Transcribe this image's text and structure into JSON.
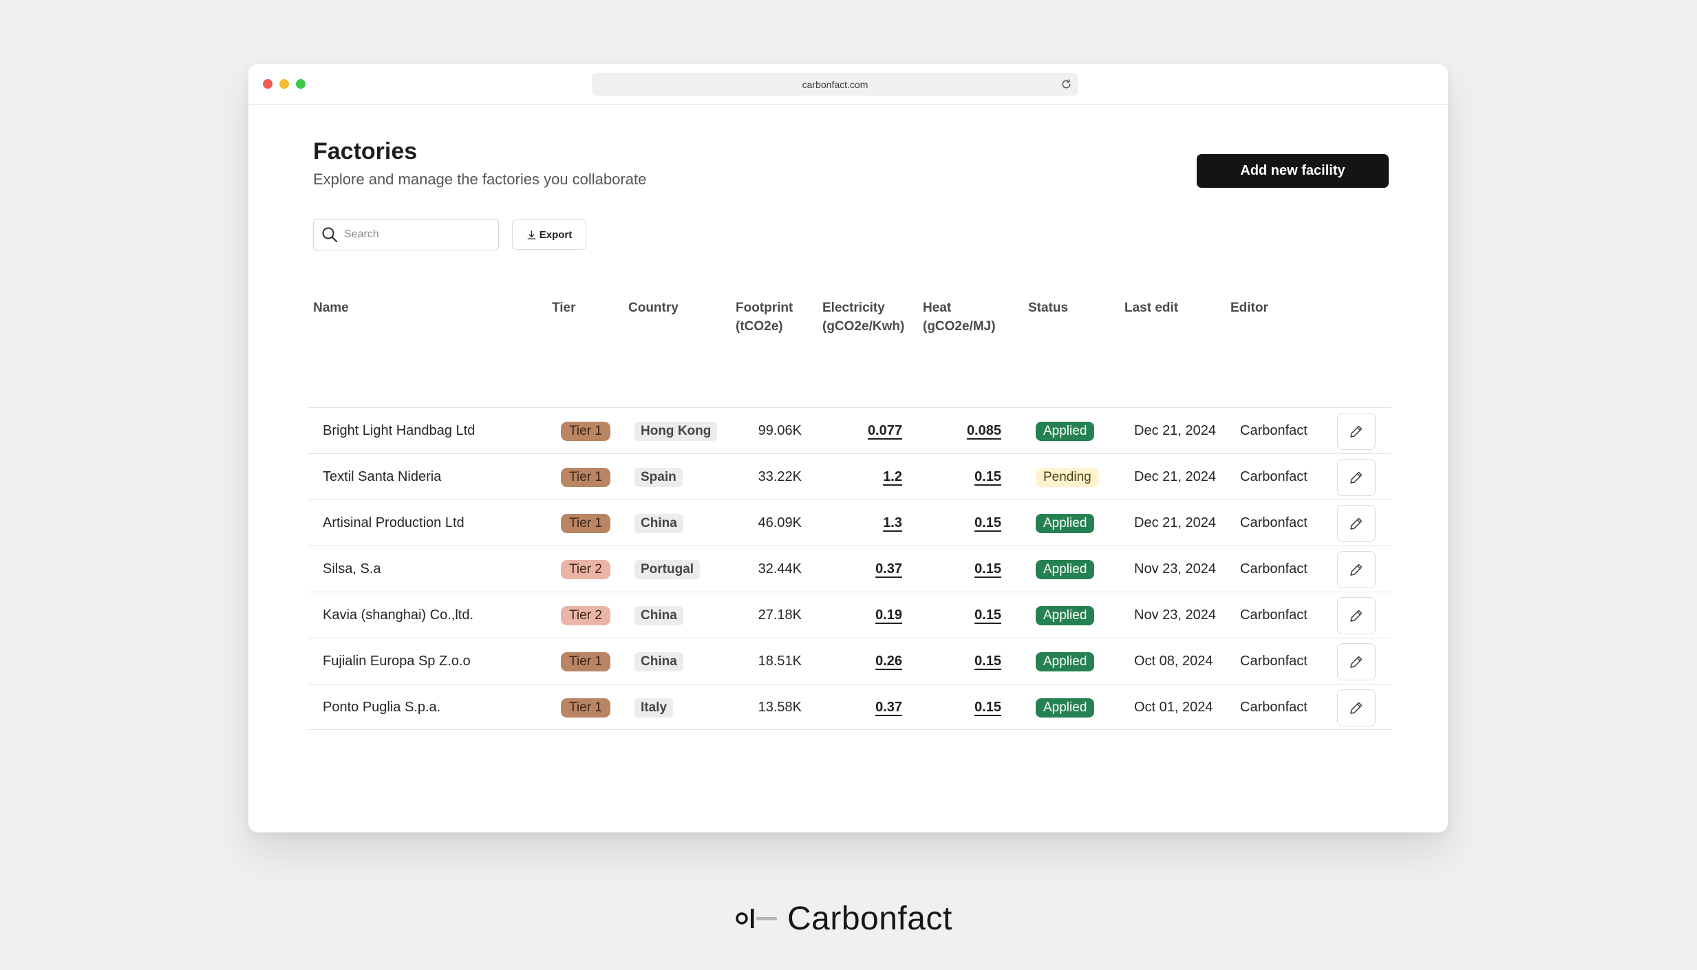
{
  "browser": {
    "url": "carbonfact.com"
  },
  "header": {
    "title": "Factories",
    "subtitle": "Explore and manage the factories you collaborate",
    "primary_action": "Add new facility"
  },
  "toolbar": {
    "search_placeholder": "Search",
    "export_label": "Export"
  },
  "table": {
    "columns": {
      "name": "Name",
      "tier": "Tier",
      "country": "Country",
      "footprint_l1": "Footprint",
      "footprint_l2": "(tCO2e)",
      "electricity_l1": "Electricity",
      "electricity_l2": "(gCO2e/Kwh)",
      "heat_l1": "Heat",
      "heat_l2": "(gCO2e/MJ)",
      "status": "Status",
      "last_edit": "Last edit",
      "editor": "Editor"
    },
    "rows": [
      {
        "name": "Bright Light Handbag Ltd",
        "tier": "Tier 1",
        "country": "Hong Kong",
        "footprint": "99.06K",
        "electricity": "0.077",
        "heat": "0.085",
        "status": "Applied",
        "last_edit": "Dec 21, 2024",
        "editor": "Carbonfact"
      },
      {
        "name": "Textil Santa Nideria",
        "tier": "Tier 1",
        "country": "Spain",
        "footprint": "33.22K",
        "electricity": "1.2",
        "heat": "0.15",
        "status": "Pending",
        "last_edit": "Dec 21, 2024",
        "editor": "Carbonfact"
      },
      {
        "name": "Artisinal Production Ltd",
        "tier": "Tier 1",
        "country": "China",
        "footprint": "46.09K",
        "electricity": "1.3",
        "heat": "0.15",
        "status": "Applied",
        "last_edit": "Dec 21, 2024",
        "editor": "Carbonfact"
      },
      {
        "name": "Silsa, S.a",
        "tier": "Tier 2",
        "country": "Portugal",
        "footprint": "32.44K",
        "electricity": "0.37",
        "heat": "0.15",
        "status": "Applied",
        "last_edit": "Nov 23, 2024",
        "editor": "Carbonfact"
      },
      {
        "name": "Kavia (shanghai) Co.,ltd.",
        "tier": "Tier 2",
        "country": "China",
        "footprint": "27.18K",
        "electricity": "0.19",
        "heat": "0.15",
        "status": "Applied",
        "last_edit": "Nov 23, 2024",
        "editor": "Carbonfact"
      },
      {
        "name": "Fujialin Europa Sp Z.o.o",
        "tier": "Tier 1",
        "country": "China",
        "footprint": "18.51K",
        "electricity": "0.26",
        "heat": "0.15",
        "status": "Applied",
        "last_edit": "Oct 08, 2024",
        "editor": "Carbonfact"
      },
      {
        "name": "Ponto Puglia S.p.a.",
        "tier": "Tier 1",
        "country": "Italy",
        "footprint": "13.58K",
        "electricity": "0.37",
        "heat": "0.15",
        "status": "Applied",
        "last_edit": "Oct 01, 2024",
        "editor": "Carbonfact"
      }
    ]
  },
  "colors": {
    "tier1_bg": "#b98563",
    "tier2_bg": "#eab5a6",
    "applied_bg": "#268152",
    "applied_fg": "#ffffff",
    "pending_bg": "#fdf4cf",
    "pending_fg": "#4a3d10"
  },
  "icons": {
    "search": "search-icon",
    "export": "download-icon",
    "edit": "pencil-icon",
    "reload": "reload-icon"
  },
  "brand": {
    "name": "Carbonfact"
  }
}
